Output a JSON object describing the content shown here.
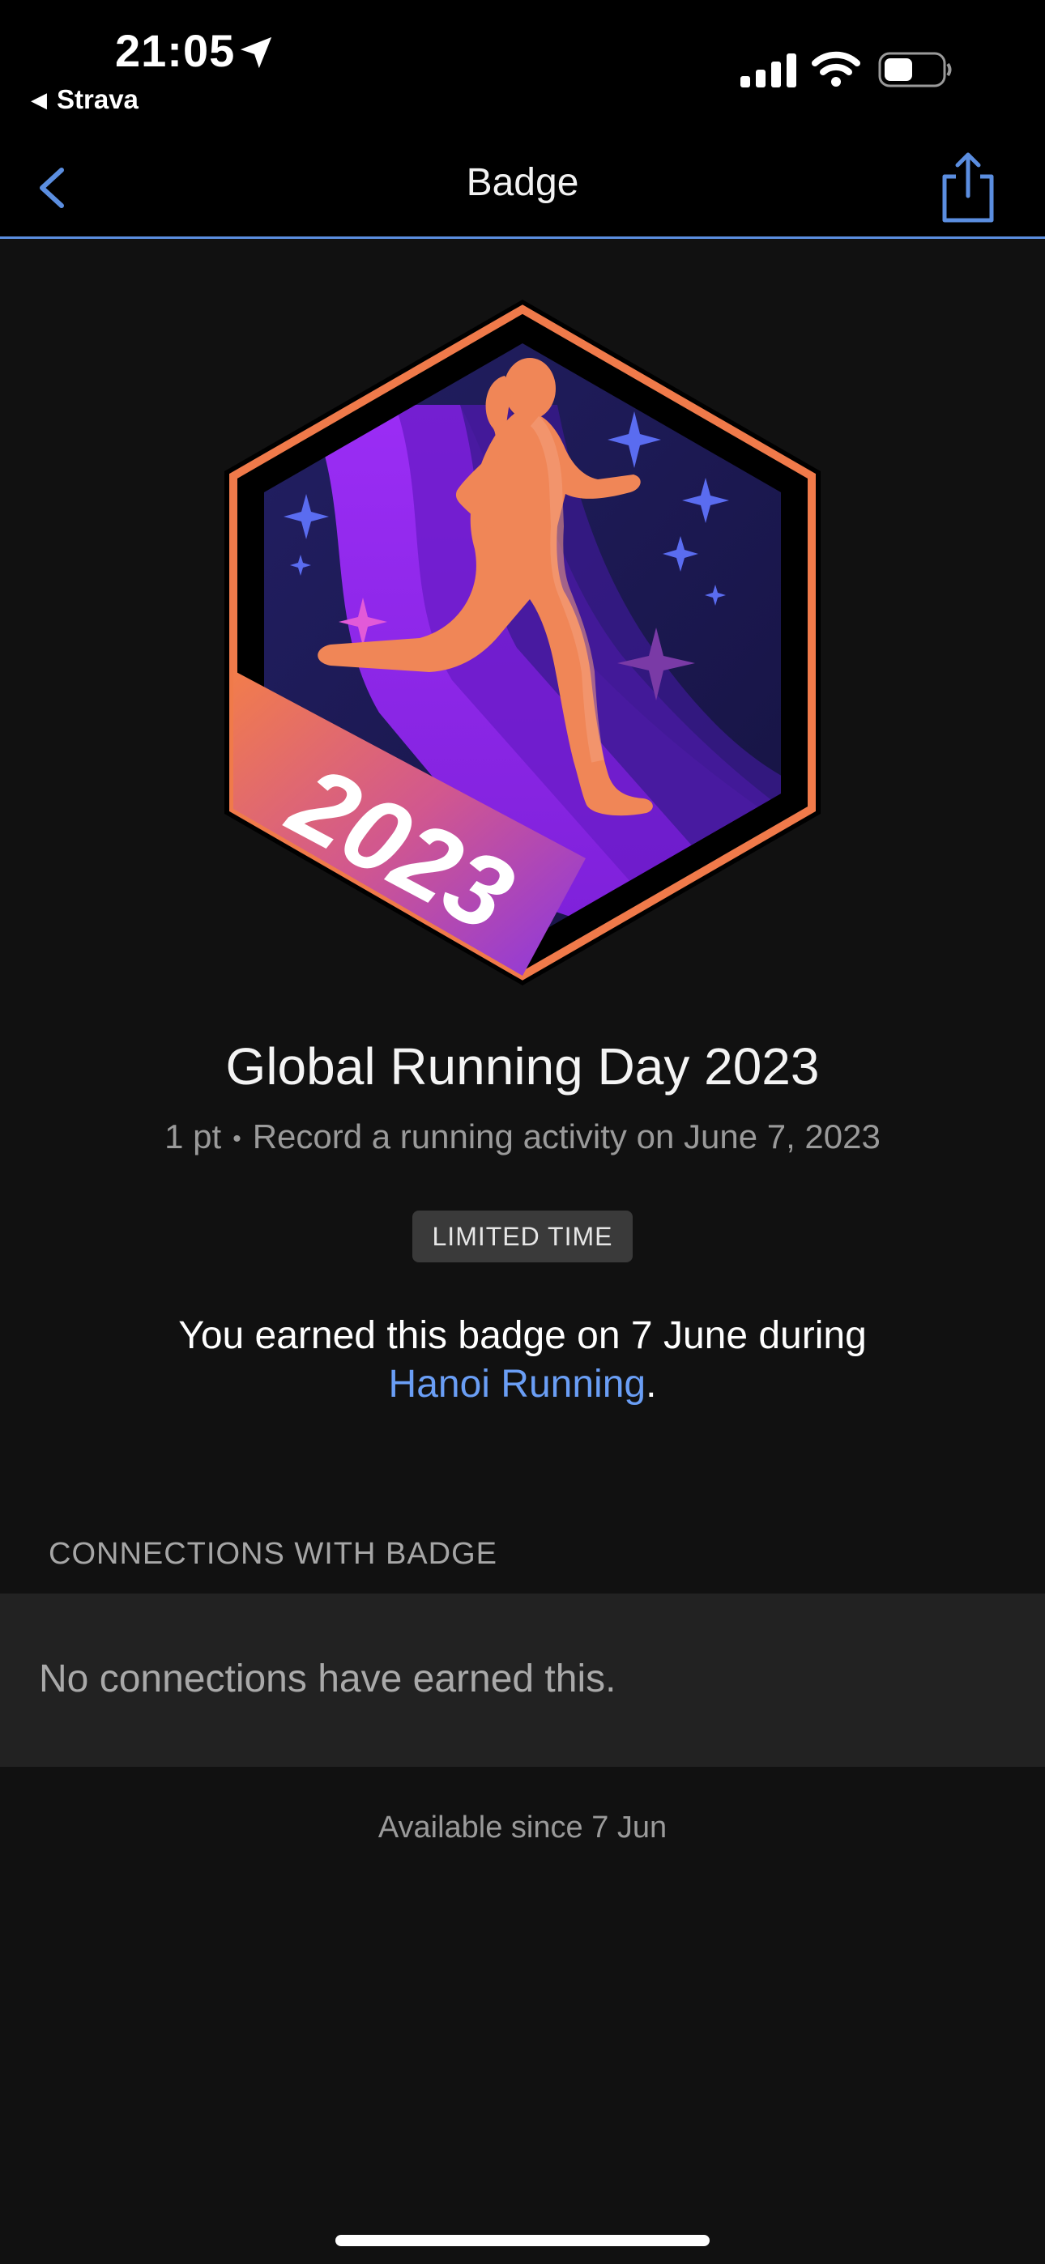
{
  "status_bar": {
    "time": "21:05",
    "back_app": "Strava",
    "icons": [
      "location-arrow-icon",
      "cellular-signal-icon",
      "wifi-icon",
      "battery-icon"
    ]
  },
  "nav": {
    "title": "Badge",
    "icons": [
      "chevron-left-icon",
      "share-icon"
    ],
    "accent_color": "#5b8ee0"
  },
  "badge": {
    "year_text": "2023",
    "name": "Global Running Day 2023",
    "points": "1 pt",
    "separator": "•",
    "description": "Record a running activity on June 7, 2023",
    "tag": "LIMITED TIME",
    "earned_prefix": "You earned this badge on 7 June during",
    "earned_link": "Hanoi Running",
    "earned_suffix": ".",
    "colors": {
      "frame": "#f07a4a",
      "purple": "#8c2ff0",
      "navy": "#1e1a55",
      "link": "#6a9ef5"
    }
  },
  "connections": {
    "header": "CONNECTIONS WITH BADGE",
    "empty_text": "No connections have earned this."
  },
  "footer": {
    "available": "Available since 7 Jun"
  }
}
